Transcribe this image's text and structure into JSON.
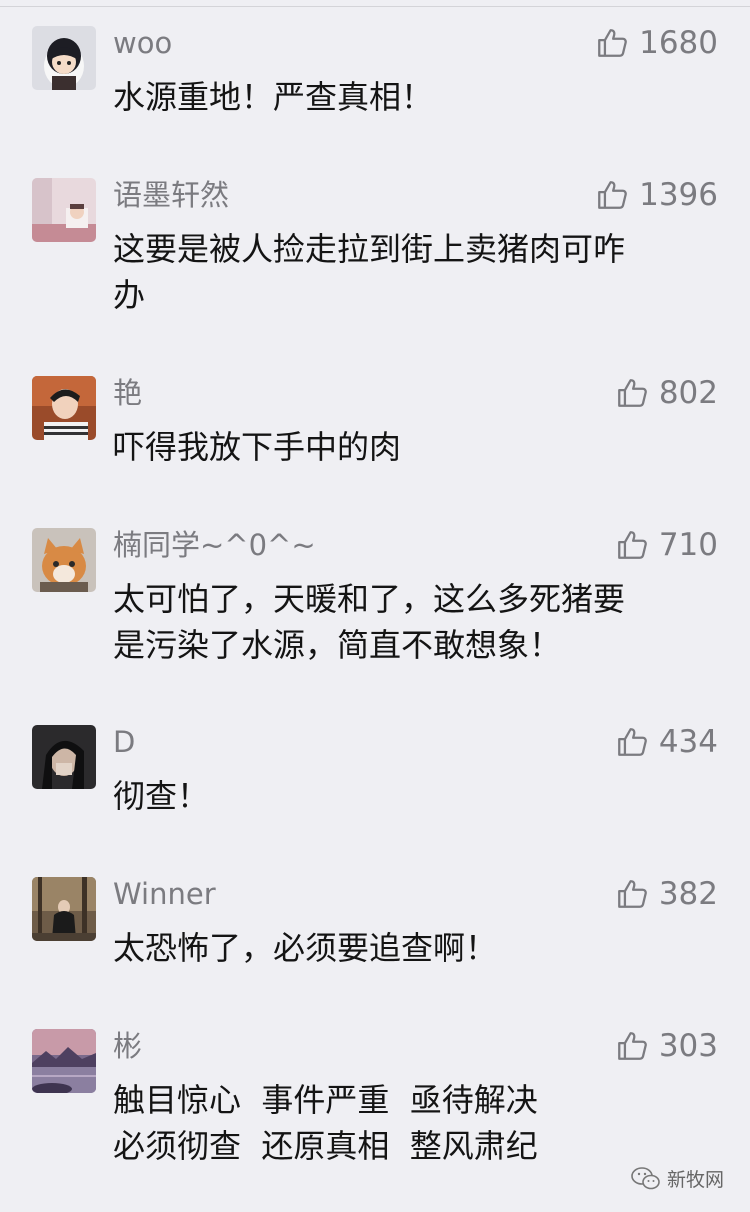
{
  "comments": [
    {
      "name": "woo",
      "likes": "1680",
      "lines": [
        "水源重地！严查真相！"
      ],
      "avatar": "anime-boy-avatar"
    },
    {
      "name": "语墨轩然",
      "likes": "1396",
      "lines": [
        "这要是被人捡走拉到街上卖猪肉可咋",
        "办"
      ],
      "avatar": "cartoon-room-avatar"
    },
    {
      "name": "艳",
      "likes": "802",
      "lines": [
        "吓得我放下手中的肉"
      ],
      "avatar": "person-photo-avatar"
    },
    {
      "name": "楠同学~^0^~",
      "likes": "710",
      "lines": [
        "太可怕了，天暖和了，这么多死猪要",
        "是污染了水源，简直不敢想象！"
      ],
      "avatar": "cat-avatar"
    },
    {
      "name": "D",
      "likes": "434",
      "lines": [
        "彻查！"
      ],
      "avatar": "dark-portrait-avatar"
    },
    {
      "name": "Winner",
      "likes": "382",
      "lines": [
        "太恐怖了，必须要追查啊！"
      ],
      "avatar": "forest-photo-avatar"
    },
    {
      "name": "彬",
      "likes": "303",
      "lines": [
        "触目惊心  事件严重  亟待解决",
        "必须彻查  还原真相  整风肃纪"
      ],
      "avatar": "lake-sunset-avatar"
    }
  ],
  "watermark": {
    "text": "新牧网",
    "icon": "wechat-icon"
  }
}
